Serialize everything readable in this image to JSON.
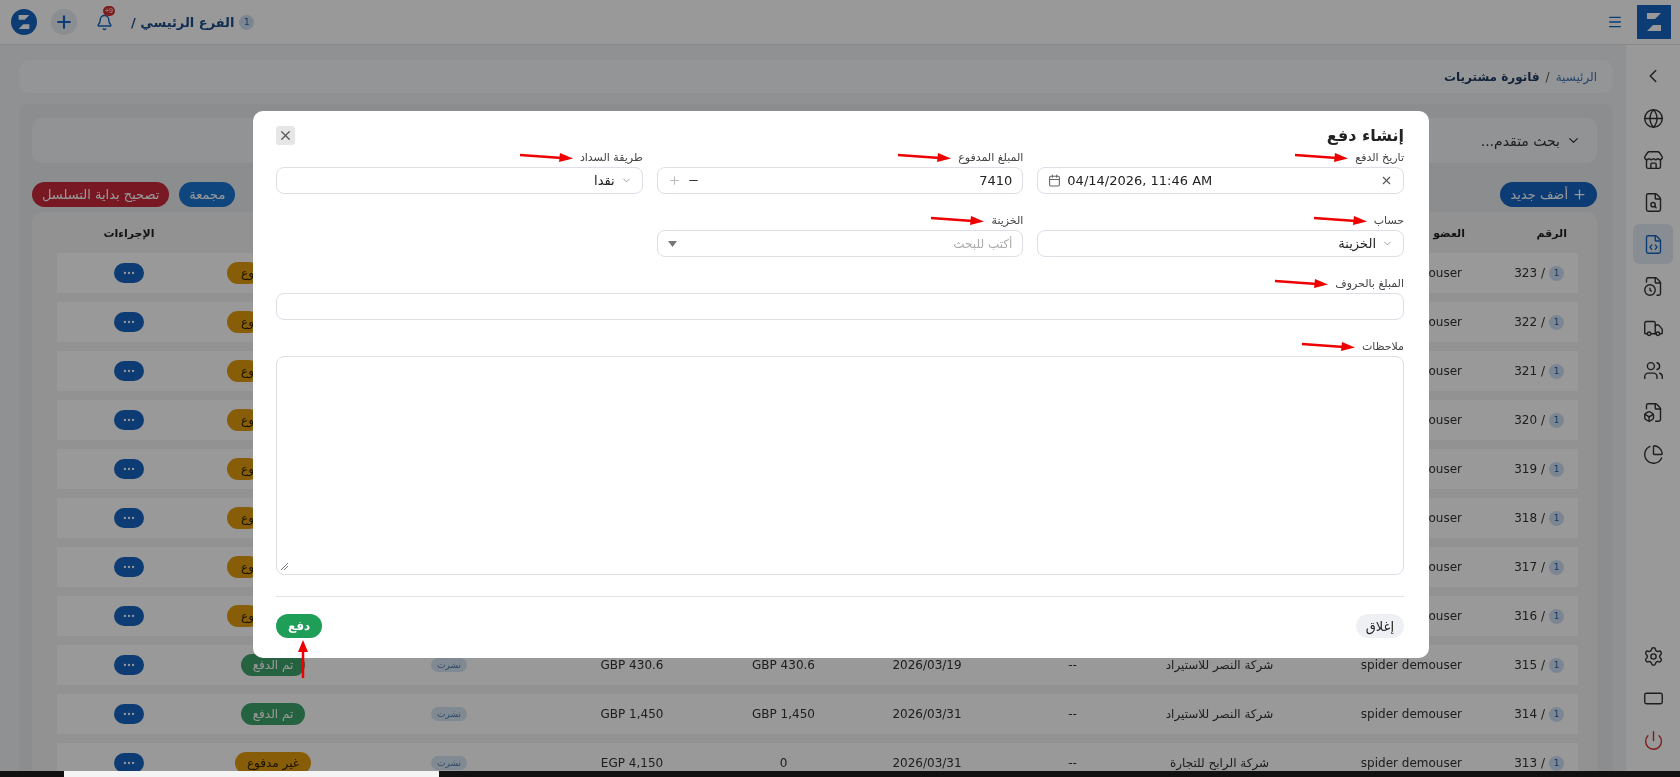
{
  "top_bar": {
    "branch_badge": "1",
    "branch": "الفرع الرئيسي /",
    "notification_count": "9+"
  },
  "sidebar": {
    "items": [
      {
        "selected": false
      },
      {
        "selected": false
      },
      {
        "selected": false
      },
      {
        "selected": true
      },
      {
        "selected": false
      },
      {
        "selected": false
      },
      {
        "selected": false
      },
      {
        "selected": false
      },
      {
        "selected": false
      },
      {
        "selected": false
      },
      {
        "selected": false
      },
      {
        "selected": false
      }
    ]
  },
  "breadcrumb": {
    "separator": "/",
    "items": [
      {
        "label": "الرئيسية",
        "current": false
      },
      {
        "label": "فاتورة مشتريات",
        "current": true
      }
    ]
  },
  "search": {
    "label": "بحث متقدم..."
  },
  "buttons": [
    {
      "label": "أضف جديد",
      "kind": "add"
    },
    {
      "label": "مجمعة",
      "kind": "bulk"
    },
    {
      "label": "تصحيح بداية التسلسل",
      "kind": "danger"
    }
  ],
  "table": {
    "headers": {
      "number": "الرقم",
      "member": "العضو",
      "actions": "الإجراءات"
    },
    "rows": [
      {
        "badge": "1",
        "number": "323 /",
        "member": "ouser",
        "status": "وع",
        "paid": false
      },
      {
        "badge": "1",
        "number": "322 /",
        "member": "ouser",
        "status": "وع",
        "paid": false
      },
      {
        "badge": "1",
        "number": "321 /",
        "member": "ouser",
        "status": "وع",
        "paid": false
      },
      {
        "badge": "1",
        "number": "320 /",
        "member": "ouser",
        "status": "وع",
        "paid": false
      },
      {
        "badge": "1",
        "number": "319 /",
        "member": "ouser",
        "status": "وع",
        "paid": false
      },
      {
        "badge": "1",
        "number": "318 /",
        "member": "ouser",
        "status": "وع",
        "paid": false
      },
      {
        "badge": "1",
        "number": "317 /",
        "member": "ouser",
        "status": "وع",
        "paid": false
      },
      {
        "badge": "1",
        "number": "316 /",
        "member": "ouser",
        "status": "وع",
        "paid": false
      },
      {
        "badge": "1",
        "number": "315 /",
        "member": "spider demouser",
        "supplier": "شركة النصر للاستيراد",
        "column_4": "--",
        "date": "2026/03/19",
        "column_6": "GBP 430.6",
        "column_7": "GBP 430.6",
        "tag": "نشرت",
        "status": "تم الدفع",
        "paid": true
      },
      {
        "badge": "1",
        "number": "314 /",
        "member": "spider demouser",
        "supplier": "شركة النصر للاستيراد",
        "column_4": "--",
        "date": "2026/03/31",
        "column_6": "GBP 1,450",
        "column_7": "GBP 1,450",
        "tag": "نشرت",
        "status": "تم الدفع",
        "paid": true
      },
      {
        "badge": "1",
        "number": "313 /",
        "member": "spider demouser",
        "supplier": "شركة الرابح للتجارة",
        "column_4": "--",
        "date": "2026/03/31",
        "column_6": "0",
        "column_7": "EGP 4,150",
        "tag": "نشرت",
        "status": "غير مدفوع",
        "paid": false
      }
    ]
  },
  "modal": {
    "title": "إنشاء دفع",
    "fields": [
      {
        "kind": "datetime",
        "label": "تاريخ الدفع",
        "value": "04/14/2026, 11:46 AM"
      },
      {
        "kind": "number",
        "label": "المبلغ المدفوع",
        "value": "7410"
      },
      {
        "kind": "select",
        "label": "طريقة السداد",
        "value": "نقدا"
      },
      {
        "kind": "select",
        "label": "حساب",
        "value": "الخزينة"
      },
      {
        "kind": "search",
        "label": "الخزينة",
        "placeholder": "أكتب للبحث"
      },
      {
        "kind": "text",
        "label": "المبلغ بالحروف"
      },
      {
        "kind": "textarea",
        "label": "ملاحظات"
      }
    ],
    "close": "إغلاق",
    "submit": "دفع"
  }
}
